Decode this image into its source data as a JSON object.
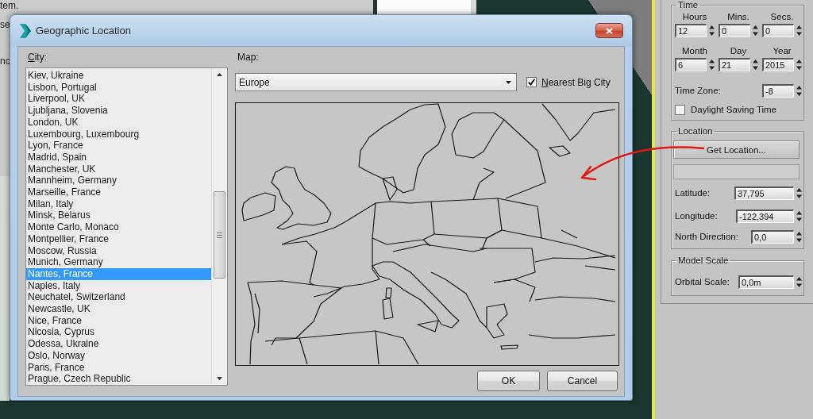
{
  "background_window": {
    "texts": [
      "tem.",
      "se",
      "nc"
    ]
  },
  "dialog": {
    "title": "Geographic Location",
    "city_label": "City:",
    "cities": [
      {
        "name": "Kiev, Ukraine",
        "selected": false
      },
      {
        "name": "Lisbon, Portugal",
        "selected": false
      },
      {
        "name": "Liverpool, UK",
        "selected": false
      },
      {
        "name": "Ljubljana, Slovenia",
        "selected": false
      },
      {
        "name": "London, UK",
        "selected": false
      },
      {
        "name": "Luxembourg, Luxembourg",
        "selected": false
      },
      {
        "name": "Lyon, France",
        "selected": false
      },
      {
        "name": "Madrid, Spain",
        "selected": false
      },
      {
        "name": "Manchester, UK",
        "selected": false
      },
      {
        "name": "Mannheim, Germany",
        "selected": false
      },
      {
        "name": "Marseille, France",
        "selected": false
      },
      {
        "name": "Milan, Italy",
        "selected": false
      },
      {
        "name": "Minsk, Belarus",
        "selected": false
      },
      {
        "name": "Monte Carlo, Monaco",
        "selected": false
      },
      {
        "name": "Montpellier, France",
        "selected": false
      },
      {
        "name": "Moscow, Russia",
        "selected": false
      },
      {
        "name": "Munich, Germany",
        "selected": false
      },
      {
        "name": "Nantes, France",
        "selected": true
      },
      {
        "name": "Naples, Italy",
        "selected": false
      },
      {
        "name": "Neuchatel, Switzerland",
        "selected": false
      },
      {
        "name": "Newcastle, UK",
        "selected": false
      },
      {
        "name": "Nice, France",
        "selected": false
      },
      {
        "name": "Nicosia, Cyprus",
        "selected": false
      },
      {
        "name": "Odessa, Ukraine",
        "selected": false
      },
      {
        "name": "Oslo, Norway",
        "selected": false
      },
      {
        "name": "Paris, France",
        "selected": false
      },
      {
        "name": "Prague, Czech Republic",
        "selected": false
      }
    ],
    "map_label": "Map:",
    "map_select": {
      "value": "Europe"
    },
    "nearest_big_city": {
      "label": "Nearest Big City",
      "checked": true
    },
    "buttons": [
      "OK",
      "Cancel"
    ]
  },
  "side_panel": {
    "time": {
      "title": "Time",
      "fields": [
        {
          "label": "Hours",
          "value": "12"
        },
        {
          "label": "Mins.",
          "value": "0"
        },
        {
          "label": "Secs.",
          "value": "0"
        },
        {
          "label": "Month",
          "value": "6"
        },
        {
          "label": "Day",
          "value": "21"
        },
        {
          "label": "Year",
          "value": "2015"
        }
      ],
      "time_zone": {
        "label": "Time Zone:",
        "value": "-8"
      },
      "daylight_saving": {
        "label": "Daylight Saving Time",
        "checked": false
      }
    },
    "location": {
      "title": "Location",
      "button": "Get Location...",
      "fields": [
        {
          "label": "Latitude:",
          "value": "37,795"
        },
        {
          "label": "Longitude:",
          "value": "-122,394"
        },
        {
          "label": "North Direction:",
          "value": "0,0"
        }
      ]
    },
    "model_scale": {
      "title": "Model Scale",
      "fields": [
        {
          "label": "Orbital Scale:",
          "value": "0,0m"
        }
      ]
    }
  }
}
